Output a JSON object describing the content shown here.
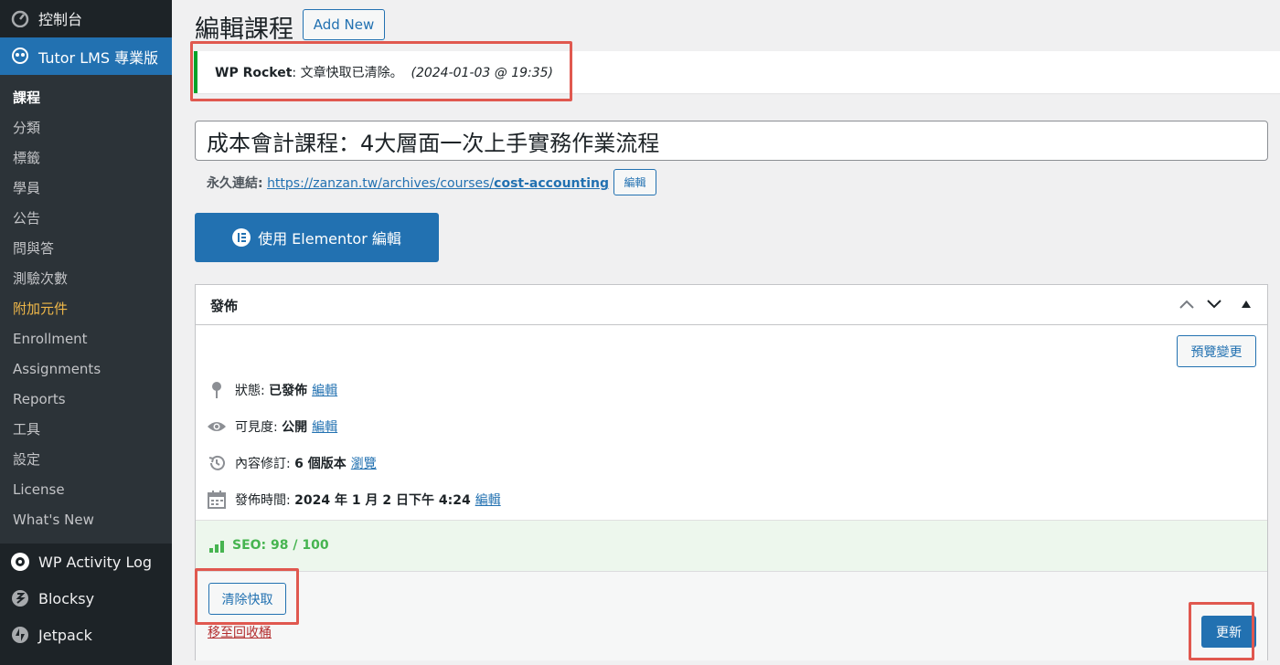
{
  "sidebar": {
    "dashboard": "控制台",
    "tutor": "Tutor LMS 專業版",
    "submenu": [
      "課程",
      "分類",
      "標籤",
      "學員",
      "公告",
      "問與答",
      "測驗次數",
      "附加元件",
      "Enrollment",
      "Assignments",
      "Reports",
      "工具",
      "設定",
      "License",
      "What's New"
    ],
    "activity_log": "WP Activity Log",
    "blocksy": "Blocksy",
    "jetpack": "Jetpack"
  },
  "header": {
    "title": "編輯課程",
    "add_new": "Add New"
  },
  "notice": {
    "plugin": "WP Rocket",
    "message": ": 文章快取已清除。",
    "timestamp": "(2024-01-03 @ 19:35)"
  },
  "post": {
    "title": "成本會計課程：4大層面一次上手實務作業流程",
    "permalink_label": "永久連結:",
    "permalink_base": "https://zanzan.tw/archives/courses/",
    "permalink_slug": "cost-accounting",
    "permalink_edit": "編輯"
  },
  "elementor": {
    "label": "使用 Elementor 編輯"
  },
  "publish": {
    "title": "發佈",
    "preview": "預覽變更",
    "status_label": "狀態:",
    "status_value": "已發佈",
    "visibility_label": "可見度:",
    "visibility_value": "公開",
    "revisions_label": "內容修訂:",
    "revisions_value": "6 個版本",
    "revisions_link": "瀏覽",
    "date_label": "發佈時間:",
    "date_value": "2024 年 1 月 2 日下午 4:24",
    "edit": "編輯",
    "seo": "SEO: 98 / 100",
    "clear_cache": "清除快取",
    "trash": "移至回收桶",
    "update": "更新"
  },
  "colors": {
    "accent": "#2271b1",
    "sidebar": "#1d2327",
    "success": "#00a32a",
    "highlight_box": "#e0584f",
    "addon_highlight": "#f0b849"
  }
}
